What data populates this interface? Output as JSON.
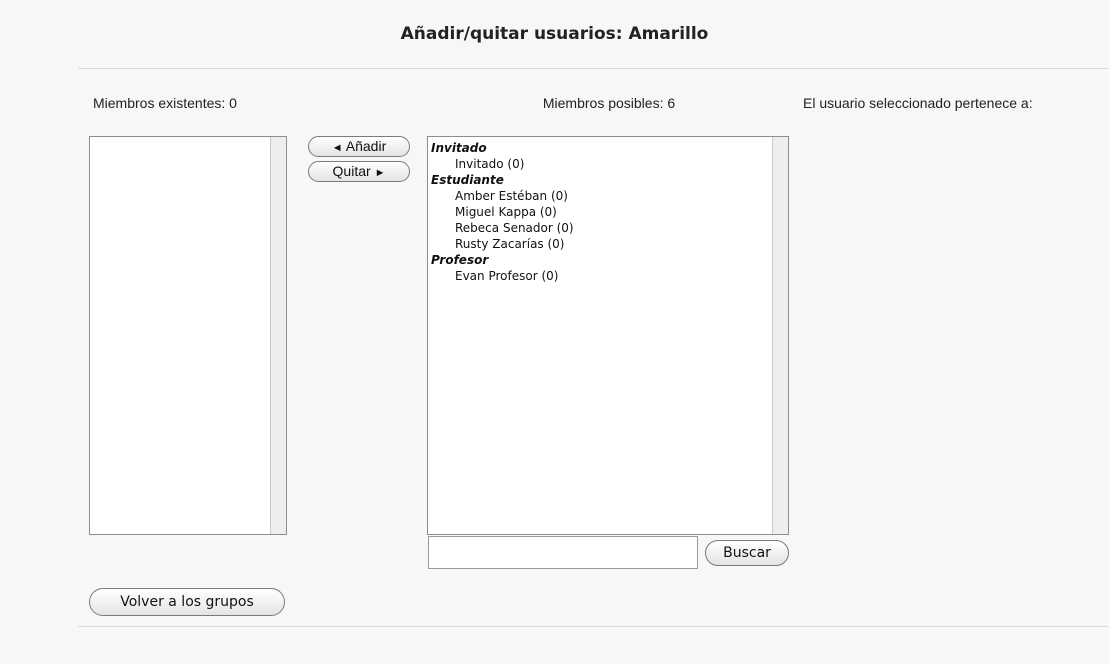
{
  "page": {
    "title": "Añadir/quitar usuarios: Amarillo"
  },
  "columns": {
    "existing_label": "Miembros existentes: 0",
    "possible_label": "Miembros posibles: 6",
    "belongs_label": "El usuario seleccionado pertenece a:"
  },
  "buttons": {
    "add_arrow": "◄",
    "add_label": "Añadir",
    "remove_label": "Quitar",
    "remove_arrow": "►",
    "search_label": "Buscar",
    "back_label": "Volver a los grupos"
  },
  "search": {
    "value": "",
    "placeholder": ""
  },
  "existing_members": [],
  "possible_members": [
    {
      "group": "Invitado",
      "options": [
        "Invitado (0)"
      ]
    },
    {
      "group": "Estudiante",
      "options": [
        "Amber Estéban (0)",
        "Miguel Kappa (0)",
        "Rebeca Senador (0)",
        "Rusty Zacarías (0)"
      ]
    },
    {
      "group": "Profesor",
      "options": [
        "Evan Profesor (0)"
      ]
    }
  ]
}
